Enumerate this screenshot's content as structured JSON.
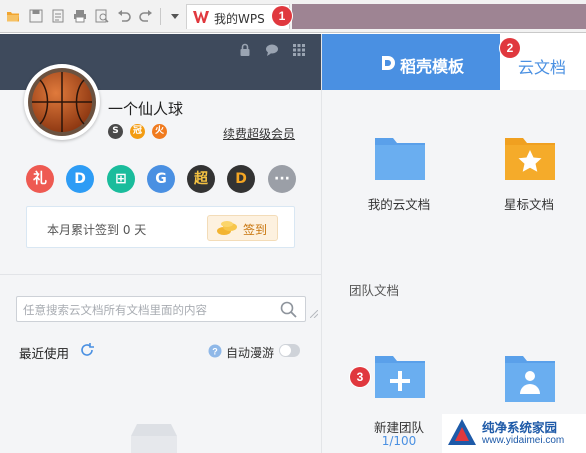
{
  "toolbar": {
    "active_tab_label": "我的WPS",
    "icons": [
      "open-folder-icon",
      "save-icon",
      "save-as-icon",
      "print-icon",
      "print-preview-icon",
      "undo-icon",
      "redo-icon",
      "dropdown-icon"
    ]
  },
  "badges": {
    "b1": "1",
    "b2": "2",
    "b3": "3"
  },
  "profile": {
    "username": "一个仙人球",
    "renew_link": "续费超级会员",
    "level_icons": [
      "S",
      "冠",
      "火"
    ]
  },
  "apps": [
    {
      "name": "gift",
      "glyph": "礼",
      "color": "#ee5a52"
    },
    {
      "name": "docs-d",
      "glyph": "D",
      "color": "#2d9cf5"
    },
    {
      "name": "plus-square",
      "glyph": "⊞",
      "color": "#1abc9c"
    },
    {
      "name": "g-app",
      "glyph": "G",
      "color": "#4a90e2"
    },
    {
      "name": "super",
      "glyph": "超",
      "color": "#333333"
    },
    {
      "name": "orange-d",
      "glyph": "D",
      "color": "#f5a623"
    },
    {
      "name": "more",
      "glyph": "···",
      "color": "#9b9fa7"
    }
  ],
  "signin": {
    "text": "本月累计签到 0 天",
    "button": "签到"
  },
  "search": {
    "placeholder": "任意搜索云文档所有文档里面的内容"
  },
  "recent": {
    "label": "最近使用"
  },
  "auto_roam": {
    "label": "自动漫游",
    "enabled": false
  },
  "right": {
    "tab_dark": "稻壳模板",
    "tab_light": "云文档",
    "my_cloud_docs": "我的云文档",
    "starred_docs": "星标文档",
    "team_docs_title": "团队文档",
    "new_team": "新建团队",
    "team_count": "1/100"
  },
  "watermark": {
    "name": "纯净系统家园",
    "url": "www.yidaimei.com"
  },
  "colors": {
    "accent": "#4a90e2",
    "dark_panel": "#3e4a5c",
    "badge_red": "#e0383e"
  }
}
